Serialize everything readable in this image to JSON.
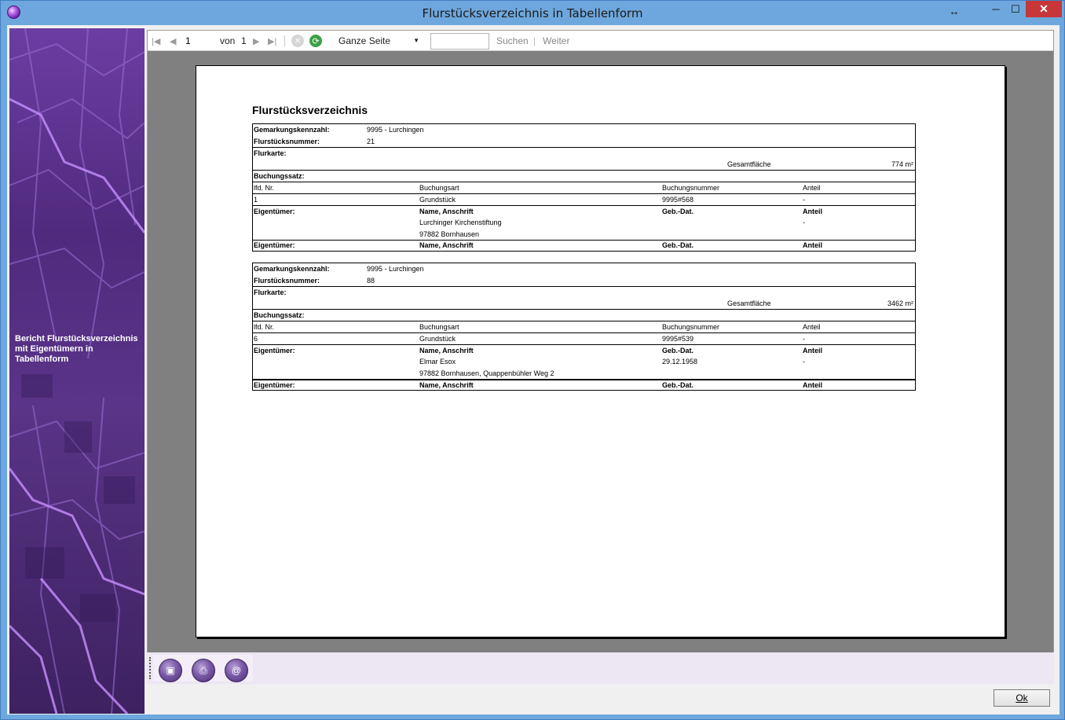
{
  "window": {
    "title": "Flurstücksverzeichnis in Tabellenform",
    "resize_glyph": "↔",
    "min_glyph": "─",
    "max_glyph": "☐",
    "close_glyph": "✕"
  },
  "banner": {
    "text": "Bericht Flurstücksverzeichnis mit Eigentümern in Tabellenform"
  },
  "toolbar": {
    "first_glyph": "|◀",
    "prev_glyph": "◀",
    "page_value": "1",
    "of_label": "von",
    "total_pages": "1",
    "next_glyph": "▶",
    "last_glyph": "▶|",
    "stop_glyph": "✕",
    "refresh_glyph": "⟳",
    "zoom_value": "Ganze Seite",
    "search_value": "",
    "search_label": "Suchen",
    "separator": "|",
    "next_label": "Weiter"
  },
  "report": {
    "title": "Flurstücksverzeichnis",
    "entries": [
      {
        "gemarkung_label": "Gemarkungskennzahl:",
        "gemarkung_value": "9995 - Lurchingen",
        "flurstueck_label": "Flurstücksnummer:",
        "flurstueck_value": "21",
        "flurkarte_label": "Flurkarte:",
        "gesamtflaeche_label": "Gesamtfläche",
        "gesamtflaeche_value": "774 m²",
        "buchungssatz_label": "Buchungssatz:",
        "col_lfd": "lfd. Nr.",
        "col_buchungsart": "Buchungsart",
        "col_buchungsnummer": "Buchungsnummer",
        "col_anteil": "Anteil",
        "lfd": "1",
        "buchungsart": "Grundstück",
        "buchungsnummer": "9995#568",
        "anteil": "-",
        "eigentuemer_label": "Eigentümer:",
        "name_header": "Name, Anschrift",
        "geb_header": "Geb.-Dat.",
        "anteil_header": "Anteil",
        "owner_name": " Lurchinger Kirchenstiftung",
        "owner_address": "97882 Bornhausen",
        "owner_geb": "",
        "owner_anteil": "-"
      },
      {
        "gemarkung_label": "Gemarkungskennzahl:",
        "gemarkung_value": "9995 - Lurchingen",
        "flurstueck_label": "Flurstücksnummer:",
        "flurstueck_value": "88",
        "flurkarte_label": "Flurkarte:",
        "gesamtflaeche_label": "Gesamtfläche",
        "gesamtflaeche_value": "3462 m²",
        "buchungssatz_label": "Buchungssatz:",
        "col_lfd": "lfd. Nr.",
        "col_buchungsart": "Buchungsart",
        "col_buchungsnummer": "Buchungsnummer",
        "col_anteil": "Anteil",
        "lfd": "6",
        "buchungsart": "Grundstück",
        "buchungsnummer": "9995#539",
        "anteil": "-",
        "eigentuemer_label": "Eigentümer:",
        "name_header": "Name, Anschrift",
        "geb_header": "Geb.-Dat.",
        "anteil_header": "Anteil",
        "owner_name": "Elmar Esox",
        "owner_address": "97882 Bornhausen, Quappenbühler Weg 2",
        "owner_geb": "29.12.1958",
        "owner_anteil": "-"
      }
    ]
  },
  "bottom_tools": {
    "save_glyph": "▣",
    "print_glyph": "⎙",
    "email_glyph": "@"
  },
  "buttons": {
    "ok_label": "Ok"
  }
}
